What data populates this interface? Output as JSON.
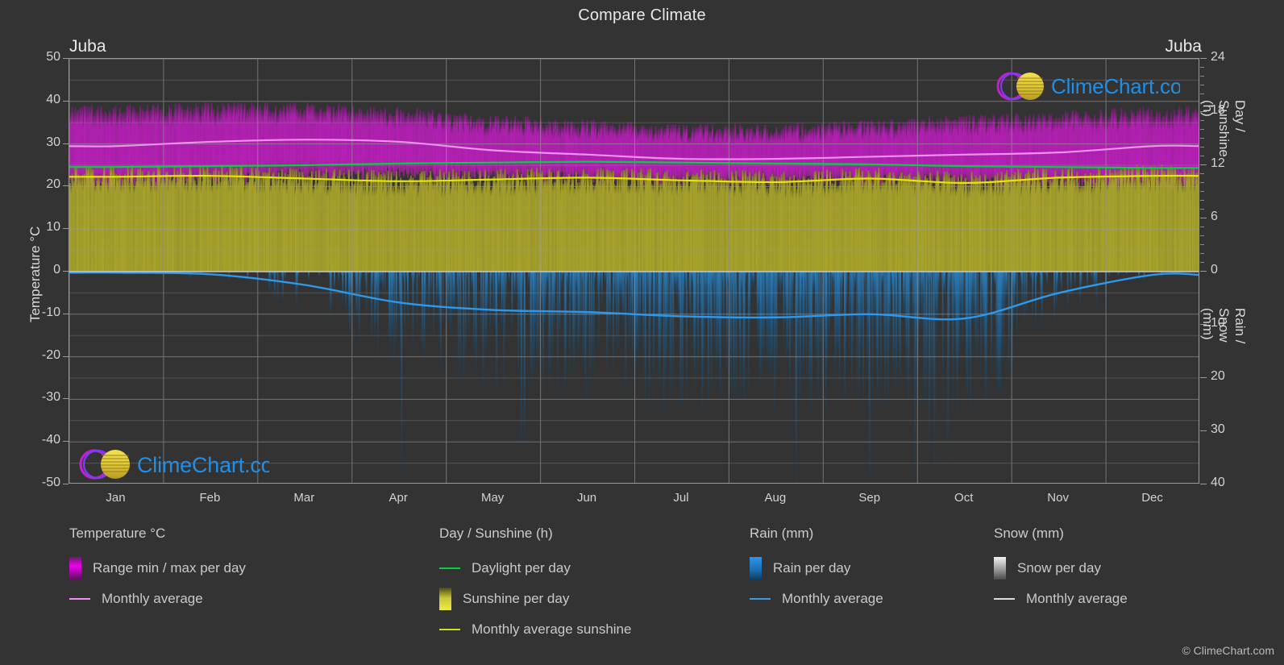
{
  "header": {
    "title": "Compare Climate"
  },
  "location": {
    "left": "Juba",
    "right": "Juba"
  },
  "axes": {
    "left_label": "Temperature °C",
    "left_ticks": [
      "50",
      "40",
      "30",
      "20",
      "10",
      "0",
      "-10",
      "-20",
      "-30",
      "-40",
      "-50"
    ],
    "right_top_label": "Day / Sunshine (h)",
    "right_top_ticks": [
      "24",
      "18",
      "12",
      "6",
      "0"
    ],
    "right_bottom_label": "Rain / Snow (mm)",
    "right_bottom_ticks": [
      "0",
      "10",
      "20",
      "30",
      "40"
    ],
    "months": [
      "Jan",
      "Feb",
      "Mar",
      "Apr",
      "May",
      "Jun",
      "Jul",
      "Aug",
      "Sep",
      "Oct",
      "Nov",
      "Dec"
    ]
  },
  "legend": {
    "temperature": {
      "heading": "Temperature °C",
      "items": [
        {
          "label": "Range min / max per day",
          "marker": "gradient",
          "color": "#ee00ee"
        },
        {
          "label": "Monthly average",
          "marker": "line",
          "color": "#ef8fef"
        }
      ]
    },
    "daysun": {
      "heading": "Day / Sunshine (h)",
      "items": [
        {
          "label": "Daylight per day",
          "marker": "line",
          "color": "#00d43c"
        },
        {
          "label": "Sunshine per day",
          "marker": "gradient",
          "color": "#e8e83c"
        },
        {
          "label": "Monthly average sunshine",
          "marker": "line",
          "color": "#d8d828"
        }
      ]
    },
    "rain": {
      "heading": "Rain (mm)",
      "items": [
        {
          "label": "Rain per day",
          "marker": "gradient",
          "color": "#1a86e0"
        },
        {
          "label": "Monthly average",
          "marker": "line",
          "color": "#3a9ae8"
        }
      ]
    },
    "snow": {
      "heading": "Snow (mm)",
      "items": [
        {
          "label": "Snow per day",
          "marker": "gradient",
          "color": "#e8e8e8"
        },
        {
          "label": "Monthly average",
          "marker": "line",
          "color": "#dddddd"
        }
      ]
    }
  },
  "watermark": {
    "brand_prefix": "Clime",
    "brand_suffix": "Chart.com",
    "copyright": "© ClimeChart.com"
  },
  "colors": {
    "background": "#333333",
    "grid": "#8d8d8d",
    "temp_range": "#c020c0",
    "temp_avg_line": "#ef8fef",
    "daylight_line": "#00d43c",
    "sunshine_fill": "#a8a32a",
    "sunshine_avg_line": "#e6e600",
    "rain_fill": "#1c6ea8",
    "rain_avg_line": "#2f98e8",
    "text": "#d2d2d2"
  },
  "chart_data": {
    "type": "area",
    "title": "Compare Climate",
    "location": "Juba",
    "x": [
      "Jan",
      "Feb",
      "Mar",
      "Apr",
      "May",
      "Jun",
      "Jul",
      "Aug",
      "Sep",
      "Oct",
      "Nov",
      "Dec"
    ],
    "xlabel": "",
    "axes": {
      "temperature": {
        "label": "Temperature °C",
        "min": -50,
        "max": 50,
        "ticks": [
          50,
          40,
          30,
          20,
          10,
          0,
          -10,
          -20,
          -30,
          -40,
          -50
        ]
      },
      "day_sunshine": {
        "label": "Day / Sunshine (h)",
        "min": 0,
        "max": 24,
        "ticks": [
          24,
          18,
          12,
          6,
          0
        ]
      },
      "rain_snow": {
        "label": "Rain / Snow (mm)",
        "min": 0,
        "max": 40,
        "ticks": [
          0,
          10,
          20,
          30,
          40
        ]
      }
    },
    "grid": true,
    "legend_position": "bottom",
    "series": [
      {
        "name": "Temperature monthly average (°C)",
        "axis": "temperature",
        "unit": "°C",
        "values": [
          29.5,
          30.5,
          31.0,
          30.5,
          28.5,
          27.5,
          26.5,
          26.5,
          27.0,
          27.5,
          28.0,
          29.5
        ]
      },
      {
        "name": "Temperature max per day (°C)",
        "axis": "temperature",
        "unit": "°C",
        "values": [
          37.5,
          38.0,
          38.0,
          37.0,
          35.0,
          34.0,
          33.0,
          33.0,
          34.0,
          35.0,
          36.0,
          37.0
        ]
      },
      {
        "name": "Temperature min per day (°C)",
        "axis": "temperature",
        "unit": "°C",
        "values": [
          20.5,
          21.5,
          23.0,
          23.0,
          22.5,
          22.0,
          21.5,
          21.5,
          21.5,
          21.5,
          21.0,
          20.5
        ]
      },
      {
        "name": "Daylight per day (h)",
        "axis": "day_sunshine",
        "unit": "h",
        "values": [
          11.8,
          11.9,
          12.0,
          12.2,
          12.3,
          12.4,
          12.3,
          12.2,
          12.1,
          11.9,
          11.8,
          11.7
        ]
      },
      {
        "name": "Monthly average sunshine (h)",
        "axis": "day_sunshine",
        "unit": "h",
        "values": [
          10.7,
          10.8,
          10.5,
          10.2,
          10.4,
          10.6,
          10.3,
          10.1,
          10.5,
          10.0,
          10.6,
          10.8
        ]
      },
      {
        "name": "Rain monthly average (mm)",
        "axis": "rain_snow",
        "unit": "mm",
        "values": [
          0.2,
          0.5,
          2.5,
          5.8,
          7.2,
          7.6,
          8.4,
          8.6,
          8.0,
          8.8,
          4.0,
          0.6
        ]
      },
      {
        "name": "Snow monthly average (mm)",
        "axis": "rain_snow",
        "unit": "mm",
        "values": [
          0,
          0,
          0,
          0,
          0,
          0,
          0,
          0,
          0,
          0,
          0,
          0
        ]
      }
    ]
  }
}
